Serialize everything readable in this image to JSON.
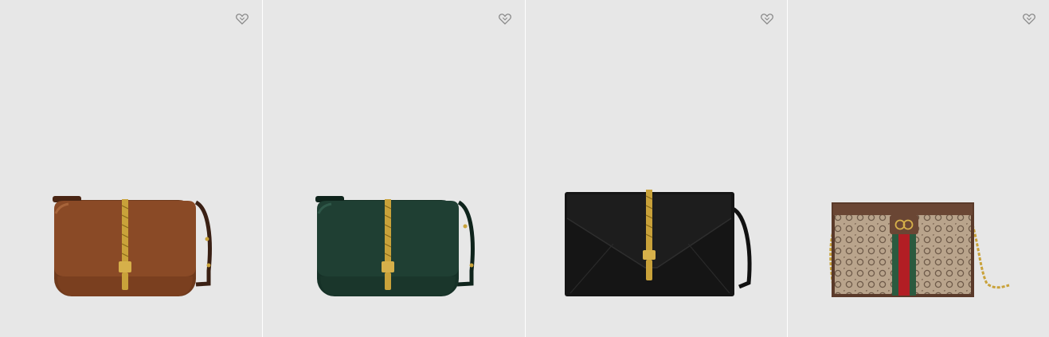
{
  "products": [
    {
      "name": "",
      "color_family": "brown",
      "style": "saddle-crossbody",
      "wishlist_icon": "heart-outline-icon"
    },
    {
      "name": "",
      "color_family": "green",
      "style": "saddle-crossbody",
      "wishlist_icon": "heart-outline-icon"
    },
    {
      "name": "",
      "color_family": "black",
      "style": "envelope-shoulder",
      "wishlist_icon": "heart-outline-icon"
    },
    {
      "name": "",
      "color_family": "gg-canvas",
      "style": "chain-shoulder",
      "wishlist_icon": "heart-outline-icon"
    }
  ],
  "colors": {
    "tile_bg": "#e7e7e7",
    "brown": "#8a4a26",
    "green": "#1f3f33",
    "black": "#151515",
    "canvas": "#b9a48c",
    "gold": "#c9a23a",
    "stripe_green": "#2b5a3f",
    "stripe_red": "#b21e24"
  }
}
